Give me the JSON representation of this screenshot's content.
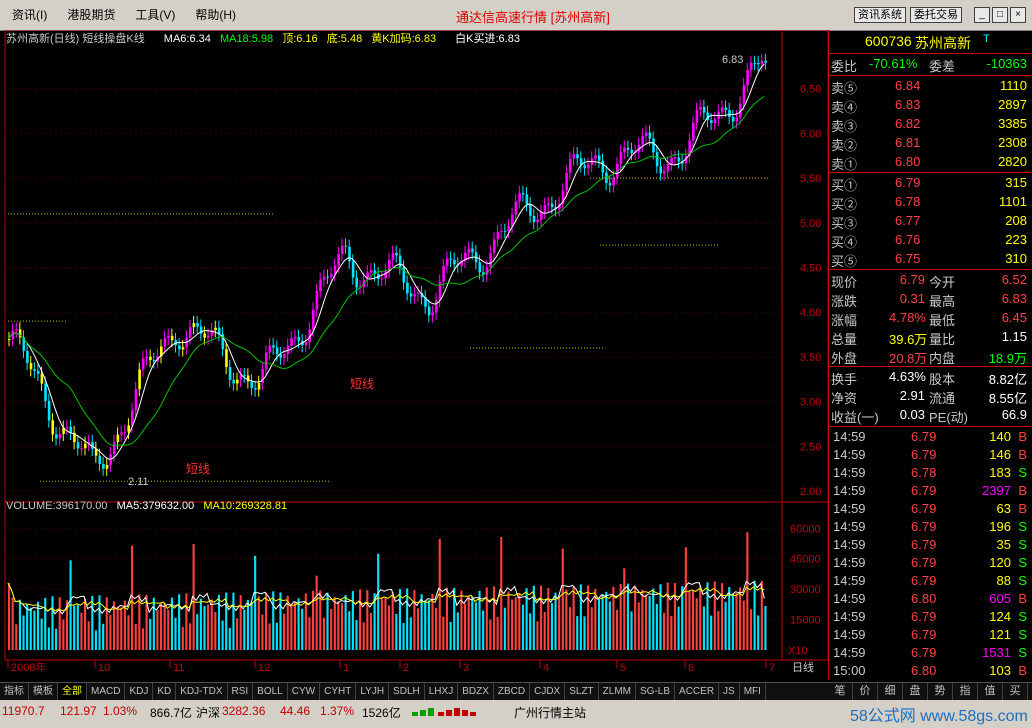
{
  "menu": [
    "资讯(I)",
    "港股期货",
    "工具(V)",
    "帮助(H)"
  ],
  "window_title": "通达信高速行情 [苏州高新]",
  "top_buttons": [
    "资讯系统",
    "委托交易"
  ],
  "window_controls": [
    "_",
    "□",
    "×"
  ],
  "chart": {
    "title": "苏州高新(日线) 短线操盘K线",
    "ma6": "MA6:6.34",
    "ma18": "MA18:5.98",
    "top": "顶:6.16",
    "bottom": "底:5.48",
    "yellow_k": "黄K加码:6.83",
    "white_k": "白K买进:6.83",
    "price_ticks": [
      "6.50",
      "6.00",
      "5.50",
      "5.00",
      "4.50",
      "4.00",
      "3.50",
      "3.00",
      "2.50",
      "2.00"
    ],
    "max_label": "6.83",
    "min_label": "2.11",
    "signal_text": "短线",
    "volume_title": "VOLUME:396170.00",
    "vol_ma5": "MA5:379632.00",
    "vol_ma10": "MA10:269328.81",
    "vol_ticks": [
      "60000",
      "45000",
      "30000",
      "15000"
    ],
    "vol_unit": "X10",
    "x_labels": [
      "2008年",
      "10",
      "11",
      "12",
      "1",
      "2",
      "3",
      "4",
      "5",
      "6",
      "7"
    ],
    "period": "日线"
  },
  "quote": {
    "code": "600736",
    "name": "苏州高新",
    "mark": "T",
    "wb_label": "委比",
    "wb_value": "-70.61%",
    "wc_label": "委差",
    "wc_value": "-10363",
    "sell": [
      {
        "label": "卖⑤",
        "price": "6.84",
        "vol": "1110"
      },
      {
        "label": "卖④",
        "price": "6.83",
        "vol": "2897"
      },
      {
        "label": "卖③",
        "price": "6.82",
        "vol": "3385"
      },
      {
        "label": "卖②",
        "price": "6.81",
        "vol": "2308"
      },
      {
        "label": "卖①",
        "price": "6.80",
        "vol": "2820"
      }
    ],
    "buy": [
      {
        "label": "买①",
        "price": "6.79",
        "vol": "315"
      },
      {
        "label": "买②",
        "price": "6.78",
        "vol": "1101"
      },
      {
        "label": "买③",
        "price": "6.77",
        "vol": "208"
      },
      {
        "label": "买④",
        "price": "6.76",
        "vol": "223"
      },
      {
        "label": "买⑤",
        "price": "6.75",
        "vol": "310"
      }
    ],
    "stats": [
      {
        "l1": "现价",
        "v1": "6.79",
        "c1": "#ff4040",
        "l2": "今开",
        "v2": "6.52",
        "c2": "#ff4040"
      },
      {
        "l1": "涨跌",
        "v1": "0.31",
        "c1": "#ff4040",
        "l2": "最高",
        "v2": "6.83",
        "c2": "#ff4040"
      },
      {
        "l1": "涨幅",
        "v1": "4.78%",
        "c1": "#ff4040",
        "l2": "最低",
        "v2": "6.45",
        "c2": "#ff4040"
      },
      {
        "l1": "总量",
        "v1": "39.6万",
        "c1": "#ffff00",
        "l2": "量比",
        "v2": "1.15",
        "c2": "#ffffff"
      },
      {
        "l1": "外盘",
        "v1": "20.8万",
        "c1": "#ff4040",
        "l2": "内盘",
        "v2": "18.9万",
        "c2": "#00ff00"
      }
    ],
    "stats2": [
      {
        "l1": "换手",
        "v1": "4.63%",
        "l2": "股本",
        "v2": "8.82亿"
      },
      {
        "l1": "净资",
        "v1": "2.91",
        "l2": "流通",
        "v2": "8.55亿"
      },
      {
        "l1": "收益(一)",
        "v1": "0.03",
        "l2": "PE(动)",
        "v2": "66.9"
      }
    ],
    "ticks": [
      {
        "time": "14:59",
        "price": "6.79",
        "vol": "140",
        "bs": "B",
        "vc": "#ffff00"
      },
      {
        "time": "14:59",
        "price": "6.79",
        "vol": "146",
        "bs": "B",
        "vc": "#ffff00"
      },
      {
        "time": "14:59",
        "price": "6.78",
        "vol": "183",
        "bs": "S",
        "vc": "#ffff00"
      },
      {
        "time": "14:59",
        "price": "6.79",
        "vol": "2397",
        "bs": "B",
        "vc": "#ff00ff"
      },
      {
        "time": "14:59",
        "price": "6.79",
        "vol": "63",
        "bs": "B",
        "vc": "#ffff00"
      },
      {
        "time": "14:59",
        "price": "6.79",
        "vol": "196",
        "bs": "S",
        "vc": "#ffff00"
      },
      {
        "time": "14:59",
        "price": "6.79",
        "vol": "35",
        "bs": "S",
        "vc": "#ffff00"
      },
      {
        "time": "14:59",
        "price": "6.79",
        "vol": "120",
        "bs": "S",
        "vc": "#ffff00"
      },
      {
        "time": "14:59",
        "price": "6.79",
        "vol": "88",
        "bs": "S",
        "vc": "#ffff00"
      },
      {
        "time": "14:59",
        "price": "6.80",
        "vol": "605",
        "bs": "B",
        "vc": "#ff00ff"
      },
      {
        "time": "14:59",
        "price": "6.79",
        "vol": "124",
        "bs": "S",
        "vc": "#ffff00"
      },
      {
        "time": "14:59",
        "price": "6.79",
        "vol": "121",
        "bs": "S",
        "vc": "#ffff00"
      },
      {
        "time": "14:59",
        "price": "6.79",
        "vol": "1531",
        "bs": "S",
        "vc": "#ff00ff"
      },
      {
        "time": "15:00",
        "price": "6.80",
        "vol": "103",
        "bs": "B",
        "vc": "#ffff00"
      }
    ]
  },
  "tabs": [
    "指标",
    "模板",
    "全部",
    "MACD",
    "KDJ",
    "KD",
    "KDJ-TDX",
    "RSI",
    "BOLL",
    "CYW",
    "CYHT",
    "LYJH",
    "SDLH",
    "LHXJ",
    "BDZX",
    "ZBCD",
    "CJDX",
    "SLZT",
    "ZLMM",
    "SG-LB",
    "ACCER",
    "JS",
    "MFI"
  ],
  "right_tabs": [
    "笔",
    "价",
    "细",
    "盘",
    "势",
    "指",
    "值",
    "买"
  ],
  "status": {
    "sh_index": "11970.7",
    "sh_chg": "121.97",
    "sh_pct": "1.03%",
    "sh_amt": "866.7亿",
    "sz_name": "沪深",
    "sz_index": "3282.36",
    "sz_chg": "44.46",
    "sz_pct": "1.37%",
    "sz_amt": "1526亿",
    "server": "广州行情主站",
    "watermark": "58公式网 www.58gs.com"
  },
  "chart_data": {
    "type": "candlestick",
    "title": "苏州高新(日线)",
    "price_range": [
      1.9,
      7.0
    ],
    "volume_range": [
      0,
      70000
    ],
    "key_points": [
      {
        "x": "2008年",
        "close": 3.7
      },
      {
        "x": "11",
        "close": 2.2,
        "low": 2.11
      },
      {
        "x": "12",
        "close": 3.9
      },
      {
        "x": "1",
        "close": 3.2
      },
      {
        "x": "2",
        "close": 4.6
      },
      {
        "x": "3",
        "close": 4.2
      },
      {
        "x": "4",
        "close": 5.0
      },
      {
        "x": "5",
        "close": 5.7
      },
      {
        "x": "6",
        "close": 5.8
      },
      {
        "x": "7",
        "close": 6.79,
        "high": 6.83
      }
    ]
  }
}
